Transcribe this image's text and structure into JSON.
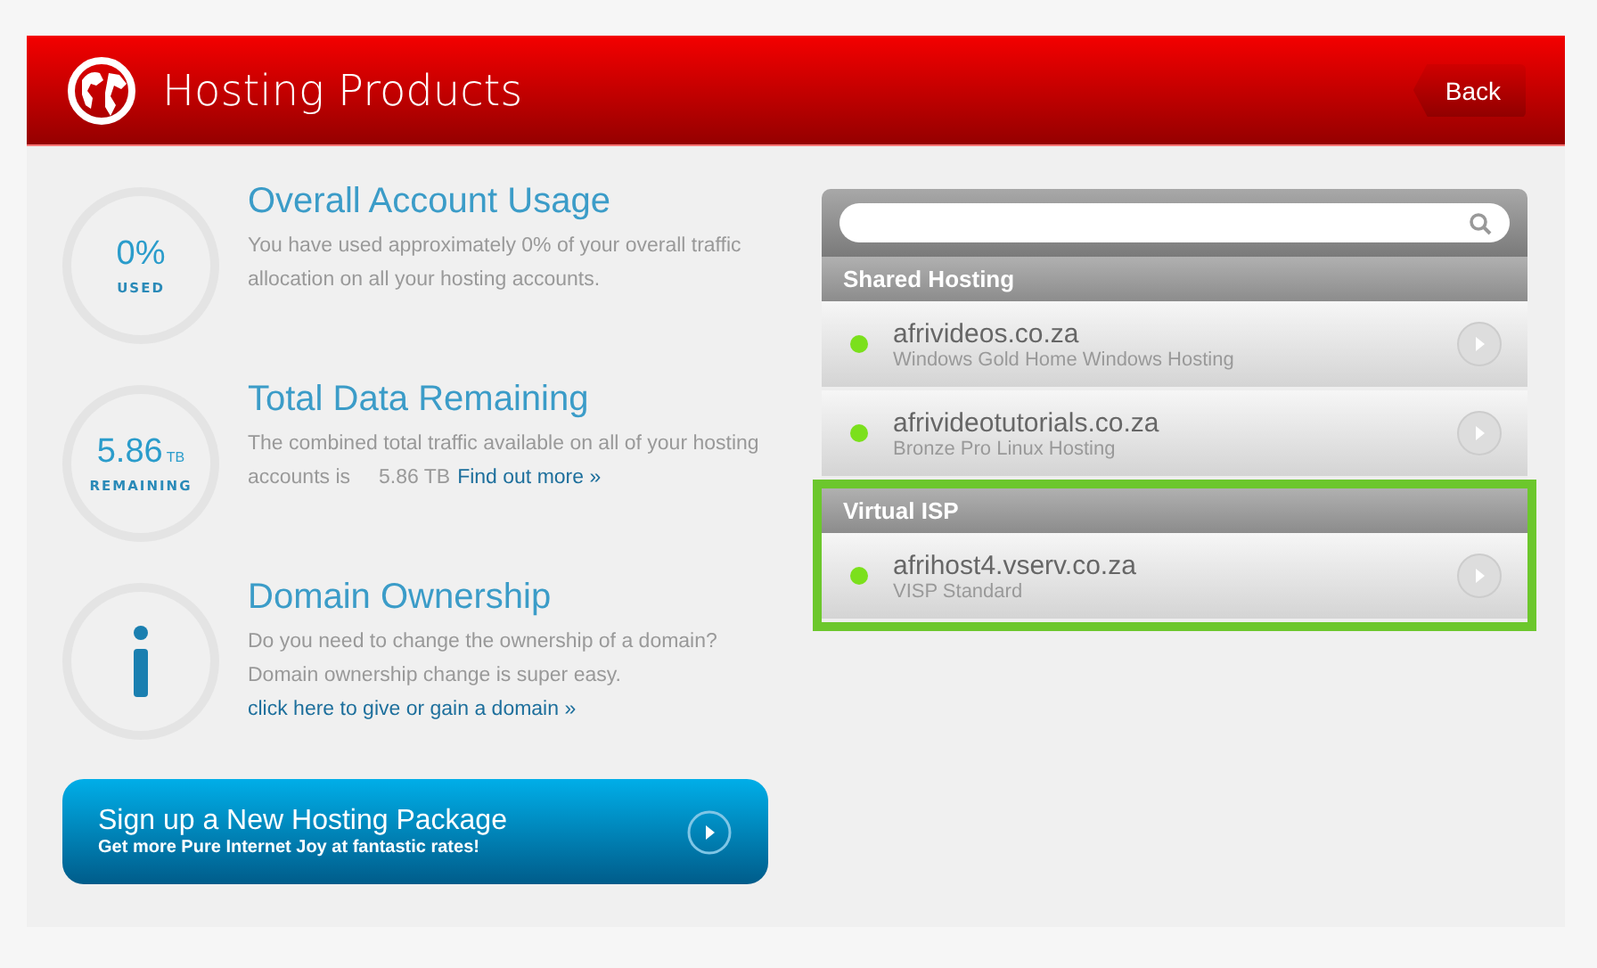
{
  "header": {
    "title": "Hosting Products",
    "back_button": "Back"
  },
  "summary": [
    {
      "kind": "gauge",
      "value": "0%",
      "caption": "USED",
      "title": "Overall Account Usage",
      "lines": [
        "You have used approximately 0% of your overall traffic allocation on all your hosting accounts."
      ]
    },
    {
      "kind": "gauge",
      "value": "5.86",
      "unit": "TB",
      "caption": "REMAINING",
      "title": "Total Data Remaining",
      "lines": [
        "The combined total traffic available on all of your hosting accounts is     5.86 TB"
      ],
      "link": "Find out more »"
    },
    {
      "kind": "info",
      "title": "Domain Ownership",
      "lines": [
        "Do you need to change the ownership of a domain?",
        "Domain ownership change is super easy."
      ],
      "link": "click here to give or gain a domain »"
    }
  ],
  "signup": {
    "title": "Sign up a New Hosting Package",
    "subtitle": "Get more Pure Internet Joy at fantastic rates!"
  },
  "groups": [
    {
      "name": "Shared Hosting",
      "highlighted": false,
      "items": [
        {
          "domain": "afrivideos.co.za",
          "plan": "Windows Gold Home Windows Hosting",
          "color": "#7be01c"
        },
        {
          "domain": "afrivideotutorials.co.za",
          "plan": "Bronze Pro Linux Hosting",
          "color": "#7be01c"
        }
      ]
    },
    {
      "name": "Virtual ISP",
      "highlighted": true,
      "items": [
        {
          "domain": "afrihost4.vserv.co.za",
          "plan": "VISP Standard",
          "color": "#7be01c"
        }
      ]
    }
  ]
}
